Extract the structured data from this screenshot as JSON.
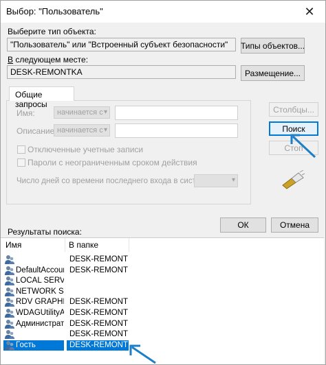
{
  "window": {
    "title": "Выбор: \"Пользователь\"",
    "close_glyph": "✕"
  },
  "object_type": {
    "label": "Выберите тип объекта:",
    "value": "\"Пользователь\" или \"Встроенный субъект безопасности\"",
    "button": "Типы объектов..."
  },
  "location": {
    "label_underlined": "В",
    "label_rest": " следующем месте:",
    "value": "DESK-REMONTKA",
    "button": "Размещение..."
  },
  "queries": {
    "tab": "Общие запросы",
    "name_label": "Имя:",
    "name_combo": "начинается с",
    "desc_label": "Описание:",
    "desc_combo": "начинается с",
    "disabled_accounts": "Отключенные учетные записи",
    "no_expire_passwords": "Пароли с неограниченным сроком действия",
    "days_since_login": "Число дней со времени последнего входа в систему:"
  },
  "side_buttons": {
    "columns": "Столбцы...",
    "search": "Поиск",
    "stop": "Стоп"
  },
  "footer": {
    "ok": "ОК",
    "cancel": "Отмена"
  },
  "results": {
    "label": "Результаты поиска:",
    "columns": [
      "Имя",
      "В папке"
    ],
    "rows": [
      {
        "name": "",
        "folder": "DESK-REMONT"
      },
      {
        "name": "DefaultAccount",
        "folder": "DESK-REMONT"
      },
      {
        "name": "LOCAL SERV",
        "folder": ""
      },
      {
        "name": "NETWORK S...",
        "folder": ""
      },
      {
        "name": "RDV GRAPHI...",
        "folder": "DESK-REMONT"
      },
      {
        "name": "WDAGUtilityA...",
        "folder": "DESK-REMONT"
      },
      {
        "name": "Администрат",
        "folder": "DESK-REMONT"
      },
      {
        "name": "",
        "folder": "DESK-REMONT"
      },
      {
        "name": "Гость",
        "folder": "DESK-REMONT",
        "selected": true
      }
    ]
  },
  "colors": {
    "accent": "#0078d7",
    "arrow": "#1e7ec8"
  }
}
